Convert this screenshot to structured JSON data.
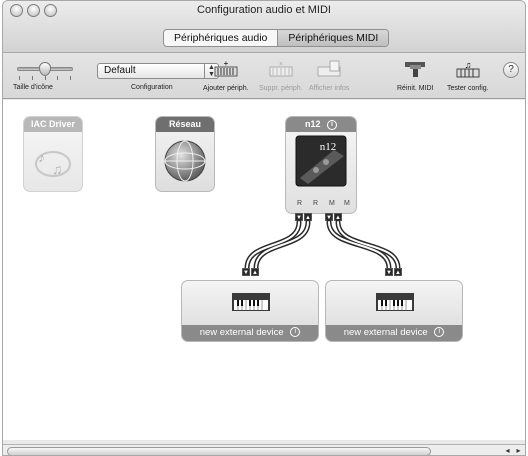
{
  "window": {
    "title": "Configuration audio et MIDI",
    "tabs": [
      {
        "label": "Périphériques audio",
        "selected": false
      },
      {
        "label": "Périphériques MIDI",
        "selected": true
      }
    ]
  },
  "toolbar": {
    "icon_size_label": "Taille d'icône",
    "configuration_label": "Configuration",
    "configuration_value": "Default",
    "add_device_label": "Ajouter périph.",
    "remove_device_label": "Suppr. périph.",
    "show_info_label": "Afficher infos",
    "reset_midi_label": "Réinit. MIDI",
    "test_setup_label": "Tester config.",
    "help_label": "?"
  },
  "devices": {
    "iac": {
      "name": "IAC Driver"
    },
    "network": {
      "name": "Réseau"
    },
    "n12": {
      "name": "n12",
      "badge": "n12",
      "ports": [
        "R",
        "R",
        "M",
        "M"
      ]
    }
  },
  "external_devices": [
    {
      "name": "new external device"
    },
    {
      "name": "new external device"
    }
  ],
  "colors": {
    "iac_header": "#b8b8b8",
    "network_header": "#6f6f6f",
    "n12_header": "#8a8a8a",
    "external_footer": "#8a8a8a"
  }
}
